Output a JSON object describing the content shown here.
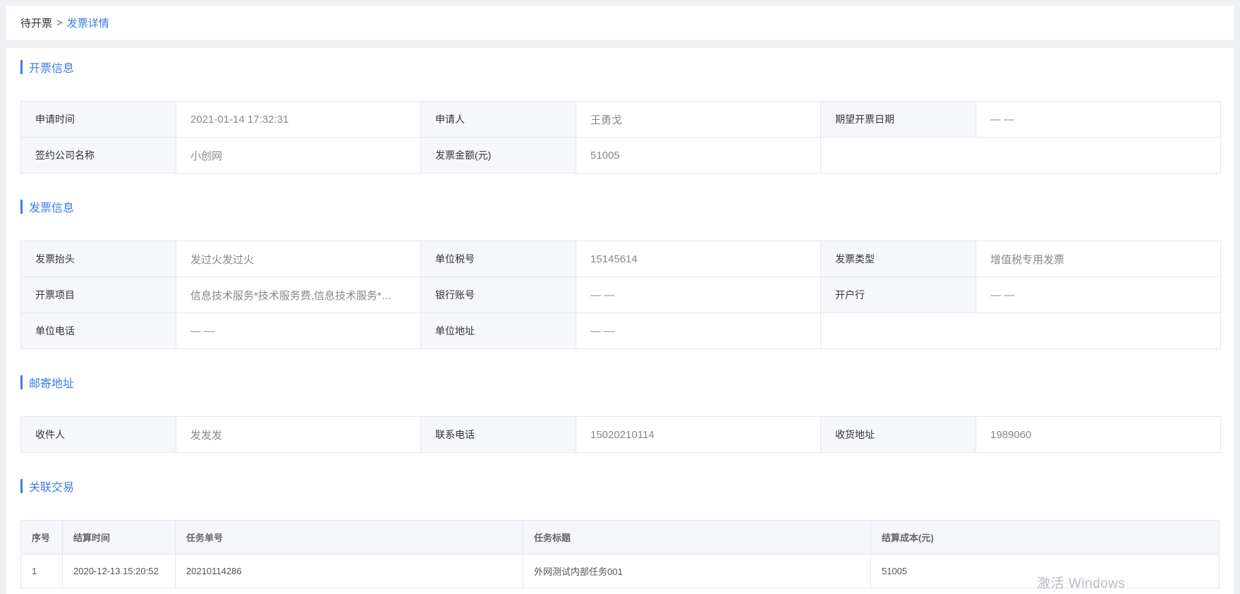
{
  "breadcrumb": {
    "root": "待开票",
    "separator": ">",
    "current": "发票详情"
  },
  "sections": {
    "billing": {
      "title": "开票信息",
      "rows": [
        [
          {
            "label": "申请时间",
            "value": "2021-01-14 17:32:31"
          },
          {
            "label": "申请人",
            "value": "王勇戈"
          },
          {
            "label": "期望开票日期",
            "value": "— —"
          }
        ],
        [
          {
            "label": "签约公司名称",
            "value": "小创网"
          },
          {
            "label": "发票金额(元)",
            "value": "51005"
          }
        ]
      ]
    },
    "invoice": {
      "title": "发票信息",
      "rows": [
        [
          {
            "label": "发票抬头",
            "value": "发过火发过火"
          },
          {
            "label": "单位税号",
            "value": "15145614"
          },
          {
            "label": "发票类型",
            "value": "增值税专用发票"
          }
        ],
        [
          {
            "label": "开票项目",
            "value": "信息技术服务*技术服务费,信息技术服务*…"
          },
          {
            "label": "银行账号",
            "value": "— —"
          },
          {
            "label": "开户行",
            "value": "— —"
          }
        ],
        [
          {
            "label": "单位电话",
            "value": "— —"
          },
          {
            "label": "单位地址",
            "value": "— —"
          }
        ]
      ]
    },
    "mailing": {
      "title": "邮寄地址",
      "rows": [
        [
          {
            "label": "收件人",
            "value": "发发发"
          },
          {
            "label": "联系电话",
            "value": "15020210114"
          },
          {
            "label": "收货地址",
            "value": "1989060"
          }
        ]
      ]
    },
    "transactions": {
      "title": "关联交易",
      "columns": [
        "序号",
        "结算时间",
        "任务单号",
        "任务标题",
        "结算成本(元)"
      ],
      "rows": [
        [
          "1",
          "2020-12-13 15:20:52",
          "20210114286",
          "外网测试内部任务001",
          "51005"
        ]
      ]
    }
  },
  "watermark": "激活 Windows",
  "colors": {
    "accent": "#3b7ddd",
    "page_background": "#eef0f4",
    "label_cell_background": "#f6f7fa",
    "border": "#e3e6ec"
  }
}
